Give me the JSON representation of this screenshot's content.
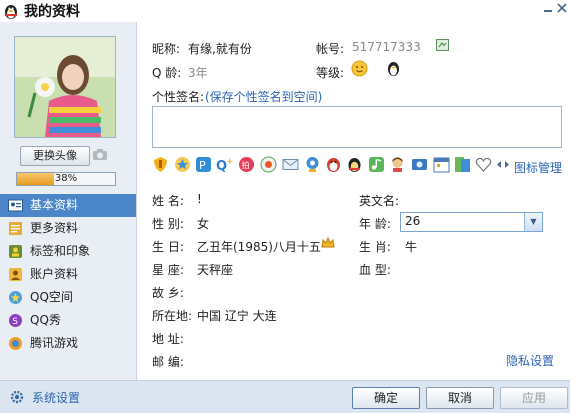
{
  "window": {
    "title": "我的资料"
  },
  "profile": {
    "nickname_label": "昵称:",
    "nickname": "有缘,就有份",
    "account_label": "帐号:",
    "account": "517717333",
    "qage_label": "Q 龄:",
    "qage": "3年",
    "level_label": "等级:",
    "signature_label": "个性签名:",
    "signature_link": "(保存个性签名到空间)",
    "signature_value": ""
  },
  "avatar": {
    "change_label": "更换头像"
  },
  "completion": {
    "percent": 38,
    "text": "38%"
  },
  "iconbar": {
    "manage_label": "图标管理"
  },
  "nav": {
    "items": [
      {
        "label": "基本资料",
        "active": true
      },
      {
        "label": "更多资料"
      },
      {
        "label": "标签和印象"
      },
      {
        "label": "账户资料"
      },
      {
        "label": "QQ空间"
      },
      {
        "label": "QQ秀"
      },
      {
        "label": "腾讯游戏"
      }
    ]
  },
  "details": {
    "name_label": "姓    名:",
    "name": "!",
    "english_label": "英文名:",
    "english": "",
    "gender_label": "性    别:",
    "gender": "女",
    "age_label": "年    龄:",
    "age": "26",
    "birthday_label": "生    日:",
    "birthday": "乙丑年(1985)八月十五",
    "zodiac_label": "生    肖:",
    "zodiac": "牛",
    "constellation_label": "星    座:",
    "constellation": "天秤座",
    "blood_label": "血    型:",
    "blood": "",
    "hometown_label": "故    乡:",
    "hometown": "",
    "location_label": "所在地:",
    "location": "中国  辽宁  大连",
    "address_label": "地    址:",
    "address": "",
    "postcode_label": "邮    编:",
    "postcode": "",
    "privacy_link": "隐私设置"
  },
  "footer": {
    "settings": "系统设置",
    "ok": "确定",
    "cancel": "取消",
    "apply": "应用"
  },
  "colors": {
    "accent": "#4a86c8",
    "link": "#2d64b3",
    "panel": "#e8eef4",
    "progress": "#e89a20"
  }
}
